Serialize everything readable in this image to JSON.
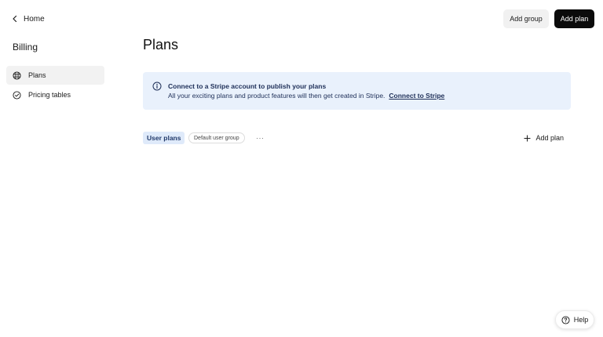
{
  "nav": {
    "back_label": "Home"
  },
  "sidebar": {
    "title": "Billing",
    "items": [
      {
        "label": "Plans",
        "icon": "plans-grid-icon",
        "active": true
      },
      {
        "label": "Pricing tables",
        "icon": "check-circle-icon",
        "active": false
      }
    ]
  },
  "header": {
    "title": "Plans",
    "add_group_label": "Add group",
    "add_plan_label": "Add plan"
  },
  "banner": {
    "icon": "info-icon",
    "heading": "Connect to a Stripe account to publish your plans",
    "body": "All your exciting plans and product features will then get created in Stripe.",
    "link_label": "Connect to Stripe",
    "background": "#e9f1fc",
    "text_color": "#1e2f58"
  },
  "groups": {
    "active_tab": "User plans",
    "default_badge": "Default user group",
    "more_label": "···",
    "add_plan_label": "Add plan"
  },
  "help": {
    "label": "Help",
    "icon": "question-circle-icon"
  },
  "colors": {
    "primary_button": "#0b0b0b",
    "secondary_button": "#f1f1f1",
    "active_tab": "#dfeafa"
  }
}
